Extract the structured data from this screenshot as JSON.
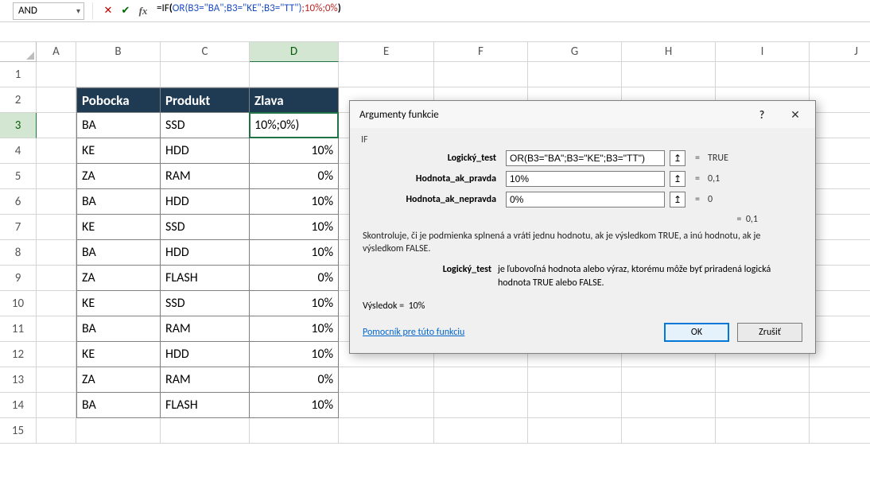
{
  "nameBox": {
    "value": "AND"
  },
  "formulaBar": {
    "plain": "=IF(OR(B3=\"BA\";B3=\"KE\";B3=\"TT\");10%;0%)",
    "parts": [
      {
        "t": "=IF",
        "c": "c-black"
      },
      {
        "t": "(",
        "c": "c-blue"
      },
      {
        "t": "OR(B3=\"BA\";B3=\"KE\";B3=\"TT\")",
        "c": "c-black"
      },
      {
        "t": ";10%;0%",
        "c": "c-black"
      },
      {
        "t": ")",
        "c": "c-blue"
      }
    ]
  },
  "columns": [
    "A",
    "B",
    "C",
    "D",
    "E",
    "F",
    "G",
    "H",
    "I",
    "J"
  ],
  "selectedCol": "D",
  "selectedRow": "3",
  "sheet": {
    "head": {
      "b": "Pobocka",
      "c": "Produkt",
      "d": "Zlava"
    },
    "active": "10%;0%)",
    "rows": [
      {
        "n": "3",
        "b": "BA",
        "c": "SSD",
        "d": "10%;0%)"
      },
      {
        "n": "4",
        "b": "KE",
        "c": "HDD",
        "d": "10%"
      },
      {
        "n": "5",
        "b": "ZA",
        "c": "RAM",
        "d": "0%"
      },
      {
        "n": "6",
        "b": "BA",
        "c": "HDD",
        "d": "10%"
      },
      {
        "n": "7",
        "b": "KE",
        "c": "SSD",
        "d": "10%"
      },
      {
        "n": "8",
        "b": "BA",
        "c": "HDD",
        "d": "10%"
      },
      {
        "n": "9",
        "b": "ZA",
        "c": "FLASH",
        "d": "0%"
      },
      {
        "n": "10",
        "b": "KE",
        "c": "SSD",
        "d": "10%"
      },
      {
        "n": "11",
        "b": "BA",
        "c": "RAM",
        "d": "10%"
      },
      {
        "n": "12",
        "b": "KE",
        "c": "HDD",
        "d": "10%"
      },
      {
        "n": "13",
        "b": "ZA",
        "c": "RAM",
        "d": "0%"
      },
      {
        "n": "14",
        "b": "BA",
        "c": "FLASH",
        "d": "10%"
      }
    ],
    "blankRows": [
      "15"
    ]
  },
  "dialog": {
    "title": "Argumenty funkcie",
    "fn": "IF",
    "args": [
      {
        "label": "Logický_test",
        "value": "OR(B3=\"BA\";B3=\"KE\";B3=\"TT\")",
        "eval": "TRUE"
      },
      {
        "label": "Hodnota_ak_pravda",
        "value": "10%",
        "eval": "0,1"
      },
      {
        "label": "Hodnota_ak_nepravda",
        "value": "0%",
        "eval": "0"
      }
    ],
    "overall_eval": "0,1",
    "desc_main": "Skontroluje, či je podmienka splnená a vráti jednu hodnotu, ak je výsledkom TRUE, a inú hodnotu, ak je výsledkom FALSE.",
    "desc_arg_label": "Logický_test",
    "desc_arg_text": "je ľubovoľná hodnota alebo výraz, ktorému môže byť priradená logická hodnota TRUE alebo FALSE.",
    "result_label": "Výsledok =",
    "result_value": "10%",
    "help_link": "Pomocník pre túto funkciu",
    "ok": "OK",
    "cancel": "Zrušiť"
  }
}
